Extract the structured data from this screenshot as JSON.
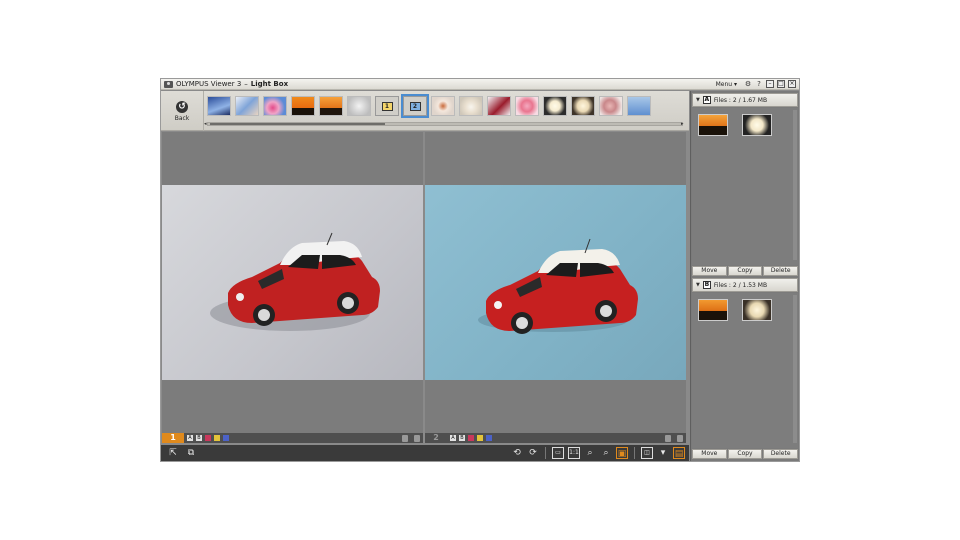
{
  "titlebar": {
    "app_name": "OLYMPUS Viewer 3",
    "separator": "–",
    "mode": "Light Box",
    "menu_label": "Menu",
    "icons": [
      "gear-icon",
      "help-icon",
      "minimize-icon",
      "maximize-icon",
      "close-icon"
    ]
  },
  "toolbar": {
    "back_label": "Back"
  },
  "strip": {
    "marker_1": "1",
    "marker_2": "2"
  },
  "panes": [
    {
      "number": "1",
      "state": "active"
    },
    {
      "number": "2",
      "state": "inactive"
    }
  ],
  "tags": [
    "A",
    "B"
  ],
  "light_box": {
    "box_a": {
      "letter": "A",
      "files": "Files : 2 / 1.67 MB"
    },
    "box_b": {
      "letter": "B",
      "files": "Files : 2 / 1.53 MB"
    },
    "buttons": {
      "move": "Move",
      "copy": "Copy",
      "delete": "Delete"
    }
  },
  "bottom_toolbar": {
    "zoom_1to1": "1:1"
  },
  "colors": {
    "accent_orange": "#e08a1d",
    "selection_blue": "#4a8cd0"
  }
}
